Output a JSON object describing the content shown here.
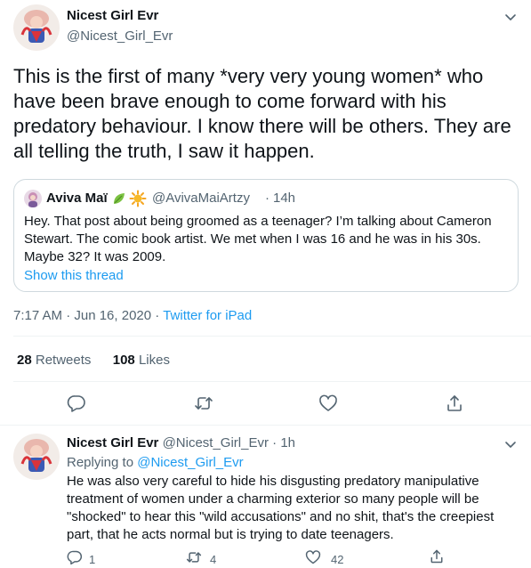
{
  "main_tweet": {
    "display_name": "Nicest Girl Evr",
    "handle": "@Nicest_Girl_Evr",
    "text": "This is the first of many *very very young women* who have been brave enough to come forward with his predatory behaviour. I know there will be others. They are all telling the truth, I saw it happen.",
    "time": "7:17 AM · Jun 16, 2020",
    "separator": "·",
    "source": "Twitter for iPad",
    "retweets_count": "28",
    "retweets_label": "Retweets",
    "likes_count": "108",
    "likes_label": "Likes"
  },
  "quoted_tweet": {
    "display_name": "Aviva Maï",
    "handle": "@AvivaMaiArtzy",
    "separator": "·",
    "time": "14h",
    "text": "Hey. That post about being groomed as a teenager? I’m talking about Cameron Stewart. The comic book artist. We met when I was 16 and he was in his 30s. Maybe 32? It was 2009.",
    "show_thread": "Show this thread"
  },
  "reply_tweet": {
    "display_name": "Nicest Girl Evr",
    "handle": "@Nicest_Girl_Evr",
    "separator": "·",
    "time": "1h",
    "replying_prefix": "Replying to ",
    "replying_handle": "@Nicest_Girl_Evr",
    "text": "He was also very careful to hide his disgusting predatory manipulative treatment of women under a charming exterior so many people will be \"shocked\" to hear this \"wild accusations\" and no shit, that's the creepiest part, that he acts normal but is trying to date teenagers.",
    "reply_count": "1",
    "retweet_count": "4",
    "like_count": "42"
  },
  "icons": {
    "caret": "chevron-down-icon",
    "reply": "reply-icon",
    "retweet": "retweet-icon",
    "like": "heart-icon",
    "share": "share-icon",
    "emoji_1": "leaf-icon",
    "emoji_2": "sun-icon"
  },
  "colors": {
    "text": "#0f1419",
    "muted": "#536471",
    "link": "#1d9bf0",
    "border": "#cfd9de"
  }
}
